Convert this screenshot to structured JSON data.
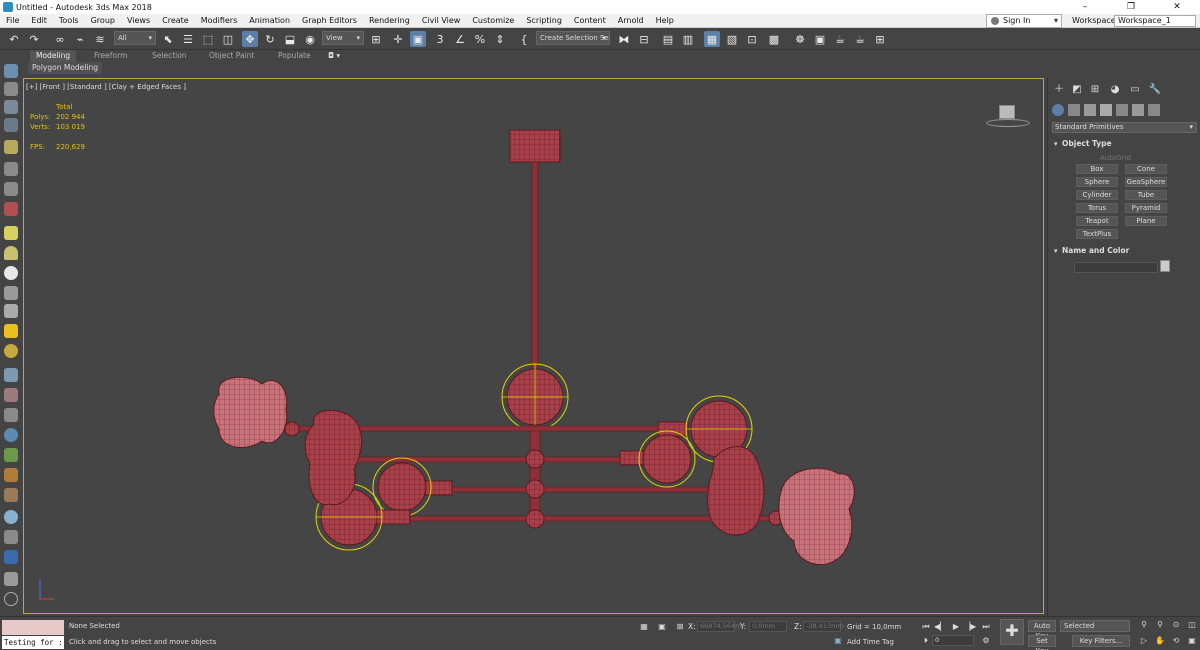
{
  "window": {
    "title": "Untitled - Autodesk 3ds Max 2018",
    "controls": [
      "–",
      "❐",
      "✕"
    ]
  },
  "menu": {
    "items": [
      "File",
      "Edit",
      "Tools",
      "Group",
      "Views",
      "Create",
      "Modifiers",
      "Animation",
      "Graph Editors",
      "Rendering",
      "Civil View",
      "Customize",
      "Scripting",
      "Content",
      "Arnold",
      "Help"
    ],
    "sign_in": "Sign In",
    "workspaces_label": "Workspaces:",
    "workspace_value": "Workspace_1"
  },
  "toolbar": {
    "selection_filter": "All",
    "ref_coord": "View",
    "create_selection_set": "Create Selection Se"
  },
  "ribbon": {
    "tabs": [
      "Modeling",
      "Freeform",
      "Selection",
      "Object Paint",
      "Populate"
    ],
    "active_tab": "Modeling",
    "sub_label": "Polygon Modeling"
  },
  "viewport": {
    "label": "[+] [Front ] [Standard ] [Clay + Edged Faces ]",
    "stats": {
      "total_label": "Total",
      "polys_label": "Polys:",
      "polys_value": "202 944",
      "verts_label": "Verts:",
      "verts_value": "103 019",
      "fps_label": "FPS:",
      "fps_value": "220,629"
    },
    "colors": {
      "background": "#454545",
      "mesh": "#a8404a",
      "wire": "#6b1f24",
      "selection": "#e3d400",
      "border": "#c8a23a"
    }
  },
  "command_panel": {
    "category": "Standard Primitives",
    "object_type_title": "Object Type",
    "autogrid": "AutoGrid",
    "primitives": [
      "Box",
      "Cone",
      "Sphere",
      "GeoSphere",
      "Cylinder",
      "Tube",
      "Torus",
      "Pyramid",
      "Teapot",
      "Plane",
      "TextPlus"
    ],
    "name_color_title": "Name and Color"
  },
  "status": {
    "maxscript_text": "Testing for :",
    "selection": "None Selected",
    "prompt": "Click and drag to select and move objects",
    "x_label": "X:",
    "x_value": "66874,564m",
    "y_label": "Y:",
    "y_value": "0,0mm",
    "z_label": "Z:",
    "z_value": "-38,413mm",
    "grid": "Grid = 10,0mm",
    "add_time_tag": "Add Time Tag",
    "frame_value": "0",
    "auto_key": "Auto Key",
    "set_key": "Set Key",
    "key_mode": "Selected",
    "key_filters": "Key Filters..."
  }
}
